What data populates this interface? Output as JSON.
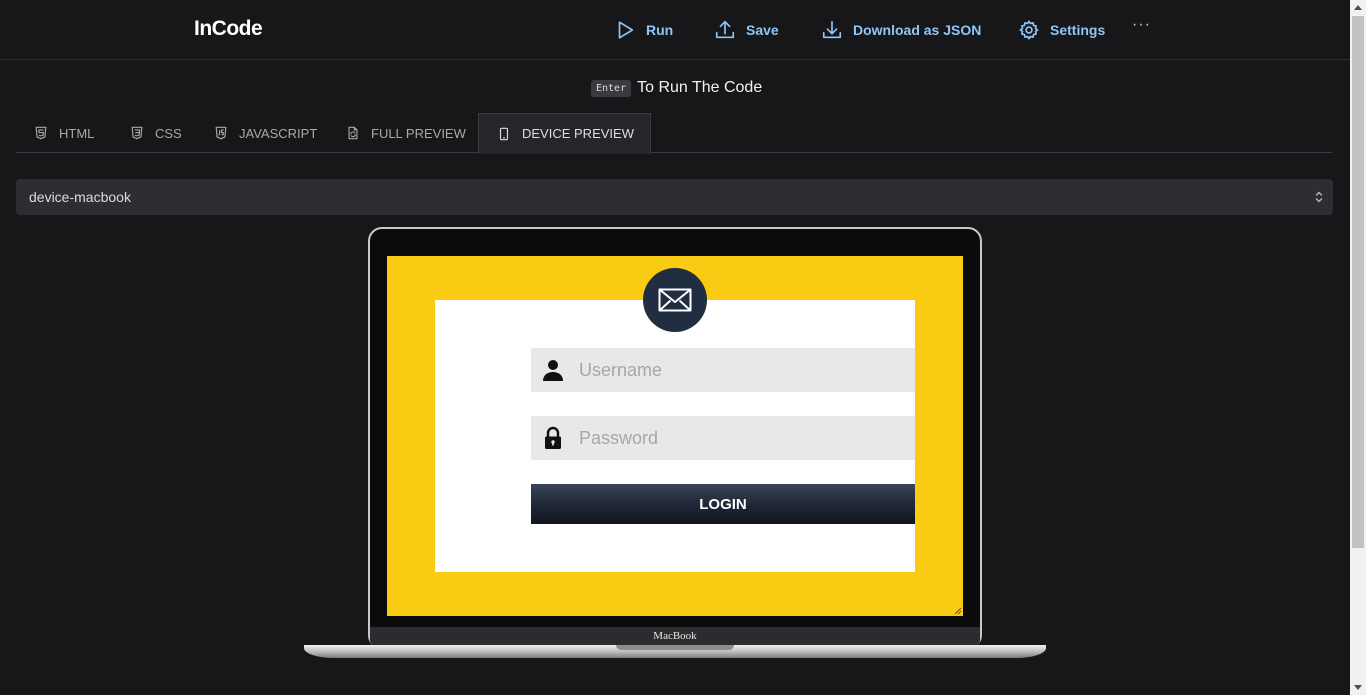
{
  "app": {
    "logo": "InCode"
  },
  "toolbar": {
    "run_label": "Run",
    "save_label": "Save",
    "download_label": "Download as JSON",
    "settings_label": "Settings",
    "more_label": "···"
  },
  "hint": {
    "key": "Enter",
    "text": "To Run The Code"
  },
  "tabs": [
    {
      "label": "HTML",
      "icon": "html5-icon"
    },
    {
      "label": "CSS",
      "icon": "css3-icon"
    },
    {
      "label": "JAVASCRIPT",
      "icon": "js-icon"
    },
    {
      "label": "FULL PREVIEW",
      "icon": "file-refresh-icon"
    },
    {
      "label": "DEVICE PREVIEW",
      "icon": "mobile-device-icon",
      "active": true
    }
  ],
  "device_select": {
    "value": "device-macbook"
  },
  "device": {
    "label": "MacBook"
  },
  "preview": {
    "username_placeholder": "Username",
    "password_placeholder": "Password",
    "login_label": "LOGIN"
  },
  "colors": {
    "background": "#17171a",
    "accent": "#8fc6f7",
    "preview_bg": "#f9cb13",
    "login_button": "#1e2637",
    "avatar_bg": "#212d40"
  }
}
